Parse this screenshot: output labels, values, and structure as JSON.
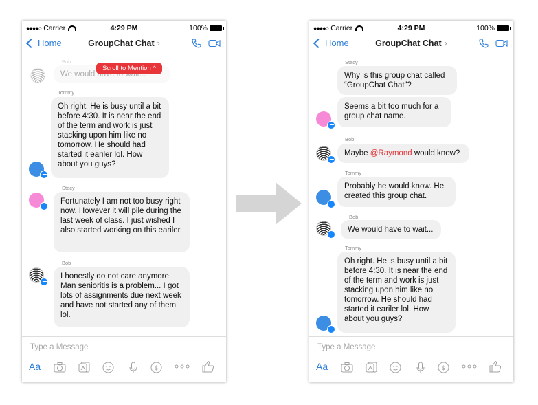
{
  "status_bar": {
    "carrier": "Carrier",
    "time": "4:29 PM",
    "battery": "100%"
  },
  "nav": {
    "back_label": "Home",
    "title": "GroupChat Chat",
    "title_arrow": "›"
  },
  "composer": {
    "placeholder": "Type a Message",
    "aa_label": "Aa"
  },
  "left": {
    "scroll_pill": "Scroll to Mention ^",
    "faded_sender": "Bob",
    "faded_message": "We would have to wait...",
    "messages": [
      {
        "sender": "Tommy",
        "text": "Oh right. He is busy until a bit before 4:30. It is near the end of the term and work is just stacking upon him like no tomorrow. He should had started it eariler lol. How about you guys?"
      },
      {
        "sender": "Stacy",
        "text": "Fortunately I am not too busy right now. However it will pile during the last week of class. I just wished I also started working on this eariler."
      },
      {
        "sender": "Bob",
        "text": "I honestly do not care anymore. Man senioritis is a problem... I got lots of assignments due next week and have not started any of them lol."
      }
    ]
  },
  "right": {
    "messages": [
      {
        "sender": "Stacy",
        "text": "Why is this group chat called “GroupChat Chat”?"
      },
      {
        "sender": "",
        "text": "Seems a bit too much for a group chat name."
      },
      {
        "sender": "Bob",
        "text_before": "Maybe ",
        "mention": "@Raymond",
        "text_after": " would know?"
      },
      {
        "sender": "Tommy",
        "text": "Probably he would know. He created this group chat."
      },
      {
        "sender": "Bob",
        "text": "We would have to wait..."
      },
      {
        "sender": "Tommy",
        "text": "Oh right. He is busy until a bit before 4:30. It is near the end of the term and work is just stacking upon him like no tomorrow. He should had started it eariler lol. How about you guys?"
      }
    ]
  },
  "icons": [
    "camera-icon",
    "sticker-icon",
    "emoji-icon",
    "microphone-icon",
    "payment-icon",
    "more-icon",
    "like-icon",
    "phone-icon",
    "video-icon"
  ],
  "colors": {
    "accent": "#2f7fdb",
    "mention": "#e0373a",
    "pill": "#e8353a",
    "bubble": "#f0f0f0"
  }
}
